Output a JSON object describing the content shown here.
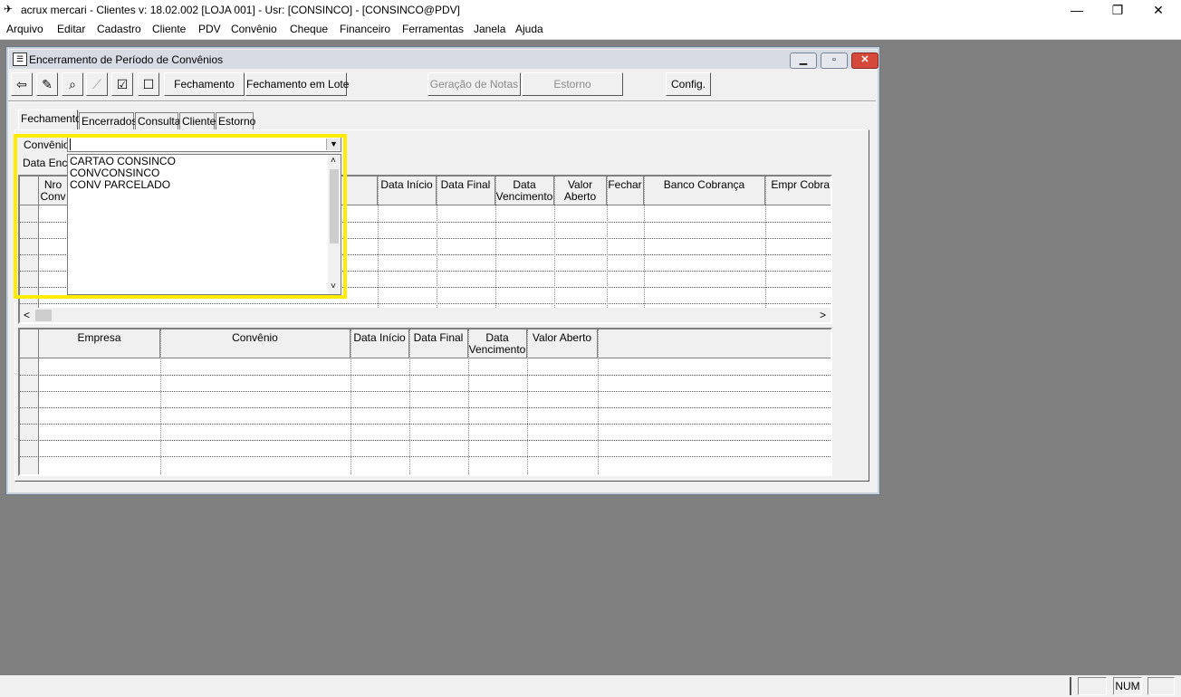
{
  "app": {
    "title": "acrux mercari - Clientes  v: 18.02.002  [LOJA 001] - Usr: [CONSINCO] - [CONSINCO@PDV]",
    "window_controls": {
      "minimize": "—",
      "restore": "❐",
      "close": "✕"
    }
  },
  "menu": [
    "Arquivo",
    "Editar",
    "Cadastro",
    "Cliente",
    "PDV",
    "Convênio",
    "Cheque",
    "Financeiro",
    "Ferramentas",
    "Janela",
    "Ajuda"
  ],
  "child": {
    "title": "Encerramento de Período de Convênios",
    "toolbar": {
      "fechamento": "Fechamento",
      "fechamento_lote": "Fechamento em Lote",
      "geracao_notas": "Geração de Notas",
      "estorno": "Estorno",
      "config": "Config."
    },
    "tabs": [
      "Fechamento",
      "Encerrados",
      "Consulta",
      "Cliente",
      "Estorno"
    ],
    "convenio_label": "Convênio",
    "data_label": "Data Enc",
    "dropdown_options": [
      "CARTAO CONSINCO",
      "CONVCONSINCO",
      "CONV PARCELADO"
    ],
    "grid1_headers": {
      "nro": "Nro Conv",
      "data_inicio": "Data Início",
      "data_final": "Data Final",
      "data_venc": "Data Vencimento",
      "valor_aberto": "Valor Aberto",
      "fechar": "Fechar",
      "banco": "Banco Cobrança",
      "empresa_cobr": "Empr Cobra"
    },
    "grid2_headers": {
      "empresa": "Empresa",
      "convenio": "Convênio",
      "data_inicio": "Data Início",
      "data_final": "Data Final",
      "data_venc": "Data Vencimento",
      "valor_aberto": "Valor Aberto"
    }
  },
  "status": {
    "num": "NUM"
  },
  "colors": {
    "highlight": "#ffec00",
    "desktop": "#808080"
  }
}
